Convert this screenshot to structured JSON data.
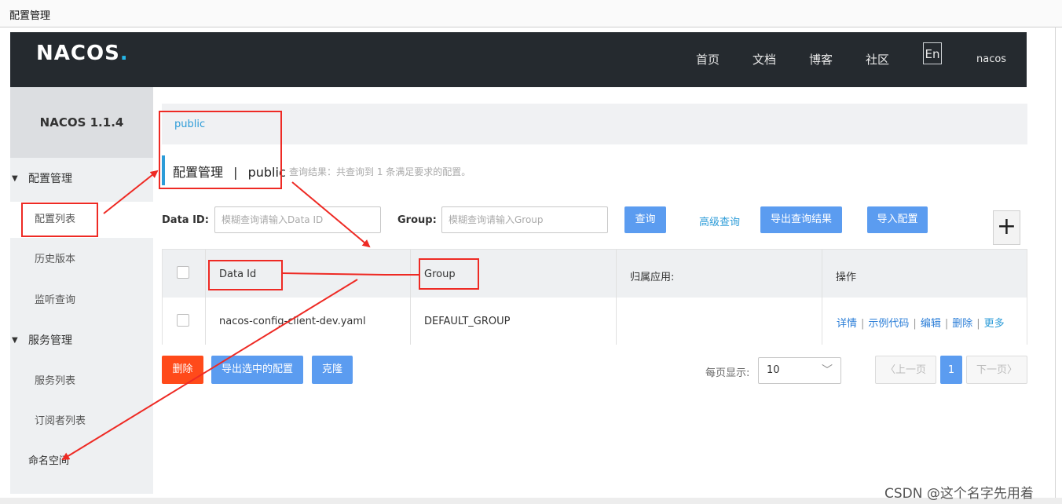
{
  "window": {
    "title": "配置管理"
  },
  "topbar": {
    "logo_main": "NACOS",
    "logo_dot": ".",
    "nav": [
      "首页",
      "文档",
      "博客",
      "社区"
    ],
    "lang": "En",
    "user": "nacos"
  },
  "sidebar": {
    "version": "NACOS 1.1.4",
    "groups": [
      {
        "label": "配置管理",
        "items": [
          "配置列表",
          "历史版本",
          "监听查询"
        ]
      },
      {
        "label": "服务管理",
        "items": [
          "服务列表",
          "订阅者列表"
        ]
      }
    ],
    "namespace": "命名空间",
    "active_item": "配置列表"
  },
  "namespace_bar": {
    "current": "public"
  },
  "page": {
    "title": "配置管理",
    "separator": "|",
    "namespace": "public",
    "query_summary": "查询结果：共查询到 1 条满足要求的配置。"
  },
  "search": {
    "dataid_label": "Data ID:",
    "dataid_placeholder": "模糊查询请输入Data ID",
    "group_label": "Group:",
    "group_placeholder": "模糊查询请输入Group",
    "query": "查询",
    "advanced": "高级查询",
    "export_results": "导出查询结果",
    "import": "导入配置",
    "add": "+"
  },
  "table": {
    "columns": [
      "Data Id",
      "Group",
      "归属应用:",
      "操作"
    ],
    "rows": [
      {
        "data_id": "nacos-config-client-dev.yaml",
        "group": "DEFAULT_GROUP",
        "app": "",
        "actions": [
          "详情",
          "示例代码",
          "编辑",
          "删除",
          "更多"
        ]
      }
    ]
  },
  "bulk": {
    "delete": "删除",
    "export_selected": "导出选中的配置",
    "clone": "克隆"
  },
  "pagination": {
    "per_page_label": "每页显示:",
    "per_page": "10",
    "prev": "上一页",
    "current": "1",
    "next": "下一页"
  },
  "watermark": "CSDN @这个名字先用着",
  "colors": {
    "accent": "#2d9cd8",
    "button": "#5b9cf0",
    "danger": "#ff4a1a",
    "header": "#252a2f",
    "annotation": "#ee2a24"
  }
}
